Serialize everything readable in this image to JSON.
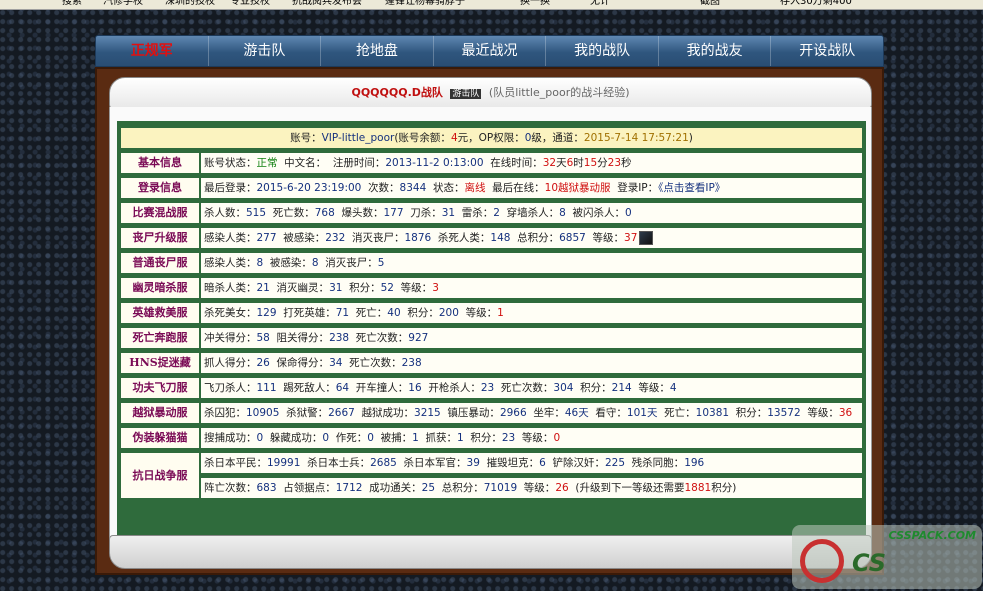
{
  "browser": {
    "items": [
      "搜索",
      "汽修学校",
      "深圳的技校",
      "专业技校",
      "抗战阅兵发布会",
      "蓬锋让杨幂骑脖子",
      "换一换",
      "无计",
      "截图",
      "存入30万剩400"
    ]
  },
  "nav": [
    "正规军",
    "游击队",
    "抢地盘",
    "最近战况",
    "我的战队",
    "我的战友",
    "开设战队"
  ],
  "header": {
    "team": "QQQQQQ.D战队",
    "badge": "游击队",
    "note": "(队员little_poor的战斗经验)"
  },
  "account": {
    "pre": "账号：",
    "id": "VIP-little_poor",
    "bal_pre": "(账号余额：",
    "bal": "4",
    "bal_unit": "元，OP权限：",
    "op": "0",
    "op_unit": "级，通道：",
    "time": "2015-7-14 17:57:21",
    "tail": ")"
  },
  "rows": [
    {
      "label": "基本信息",
      "parts": [
        [
          "k",
          "账号状态："
        ],
        [
          "g",
          "正常"
        ],
        [
          "k",
          "  中文名：  注册时间："
        ],
        [
          "n",
          "2013-11-2 0:13:00"
        ],
        [
          "k",
          "  在线时间："
        ],
        [
          "r",
          "32"
        ],
        [
          "k",
          "天"
        ],
        [
          "r",
          "6"
        ],
        [
          "k",
          "时"
        ],
        [
          "r",
          "15"
        ],
        [
          "k",
          "分"
        ],
        [
          "r",
          "23"
        ],
        [
          "k",
          "秒"
        ]
      ]
    },
    {
      "label": "登录信息",
      "parts": [
        [
          "k",
          "最后登录："
        ],
        [
          "n",
          "2015-6-20 23:19:00"
        ],
        [
          "k",
          "  次数："
        ],
        [
          "n",
          "8344"
        ],
        [
          "k",
          "  状态："
        ],
        [
          "r",
          "离线"
        ],
        [
          "k",
          "  最后在线："
        ],
        [
          "r",
          "10越狱暴动服"
        ],
        [
          "k",
          "  登录IP："
        ],
        [
          "n",
          "《点击查看IP》"
        ]
      ]
    },
    {
      "label": "比赛混战服",
      "parts": [
        [
          "k",
          "杀人数："
        ],
        [
          "n",
          "515"
        ],
        [
          "k",
          "  死亡数："
        ],
        [
          "n",
          "768"
        ],
        [
          "k",
          "  爆头数："
        ],
        [
          "n",
          "177"
        ],
        [
          "k",
          "  刀杀："
        ],
        [
          "n",
          "31"
        ],
        [
          "k",
          "  雷杀："
        ],
        [
          "n",
          "2"
        ],
        [
          "k",
          "  穿墙杀人："
        ],
        [
          "n",
          "8"
        ],
        [
          "k",
          "  被闪杀人："
        ],
        [
          "n",
          "0"
        ]
      ]
    },
    {
      "label": "丧尸升级服",
      "parts": [
        [
          "k",
          "感染人类："
        ],
        [
          "n",
          "277"
        ],
        [
          "k",
          "  被感染："
        ],
        [
          "n",
          "232"
        ],
        [
          "k",
          "  消灭丧尸："
        ],
        [
          "n",
          "1876"
        ],
        [
          "k",
          "  杀死人类："
        ],
        [
          "n",
          "148"
        ],
        [
          "k",
          "  总积分："
        ],
        [
          "n",
          "6857"
        ],
        [
          "k",
          "  等级："
        ],
        [
          "r",
          "37"
        ]
      ],
      "thumb": true
    },
    {
      "label": "普通丧尸服",
      "parts": [
        [
          "k",
          "感染人类："
        ],
        [
          "n",
          "8"
        ],
        [
          "k",
          "  被感染："
        ],
        [
          "n",
          "8"
        ],
        [
          "k",
          "  消灭丧尸："
        ],
        [
          "n",
          "5"
        ]
      ]
    },
    {
      "label": "幽灵暗杀服",
      "parts": [
        [
          "k",
          "暗杀人类："
        ],
        [
          "n",
          "21"
        ],
        [
          "k",
          "  消灭幽灵："
        ],
        [
          "n",
          "31"
        ],
        [
          "k",
          "  积分："
        ],
        [
          "n",
          "52"
        ],
        [
          "k",
          "  等级："
        ],
        [
          "r",
          "3"
        ]
      ]
    },
    {
      "label": "英雄救美服",
      "parts": [
        [
          "k",
          "杀死美女："
        ],
        [
          "n",
          "129"
        ],
        [
          "k",
          "  打死英雄："
        ],
        [
          "n",
          "71"
        ],
        [
          "k",
          "  死亡："
        ],
        [
          "n",
          "40"
        ],
        [
          "k",
          "  积分："
        ],
        [
          "n",
          "200"
        ],
        [
          "k",
          "  等级："
        ],
        [
          "r",
          "1"
        ]
      ]
    },
    {
      "label": "死亡奔跑服",
      "parts": [
        [
          "k",
          "冲关得分："
        ],
        [
          "n",
          "58"
        ],
        [
          "k",
          "  阻关得分："
        ],
        [
          "n",
          "238"
        ],
        [
          "k",
          "  死亡次数："
        ],
        [
          "n",
          "927"
        ]
      ]
    },
    {
      "label": "HNS捉迷藏",
      "parts": [
        [
          "k",
          "抓人得分："
        ],
        [
          "n",
          "26"
        ],
        [
          "k",
          "  保命得分："
        ],
        [
          "n",
          "34"
        ],
        [
          "k",
          "  死亡次数："
        ],
        [
          "n",
          "238"
        ]
      ]
    },
    {
      "label": "功夫飞刀服",
      "parts": [
        [
          "k",
          "飞刀杀人："
        ],
        [
          "n",
          "111"
        ],
        [
          "k",
          "  踢死敌人："
        ],
        [
          "n",
          "64"
        ],
        [
          "k",
          "  开车撞人："
        ],
        [
          "n",
          "16"
        ],
        [
          "k",
          "  开枪杀人："
        ],
        [
          "n",
          "23"
        ],
        [
          "k",
          "  死亡次数："
        ],
        [
          "n",
          "304"
        ],
        [
          "k",
          "  积分："
        ],
        [
          "n",
          "214"
        ],
        [
          "k",
          "  等级："
        ],
        [
          "n",
          "4"
        ]
      ]
    },
    {
      "label": "越狱暴动服",
      "parts": [
        [
          "k",
          "杀囚犯："
        ],
        [
          "n",
          "10905"
        ],
        [
          "k",
          "  杀狱警："
        ],
        [
          "n",
          "2667"
        ],
        [
          "k",
          "  越狱成功："
        ],
        [
          "n",
          "3215"
        ],
        [
          "k",
          "  镇压暴动："
        ],
        [
          "n",
          "2966"
        ],
        [
          "k",
          "  坐牢："
        ],
        [
          "n",
          "46天"
        ],
        [
          "k",
          "  看守："
        ],
        [
          "n",
          "101天"
        ],
        [
          "k",
          "  死亡："
        ],
        [
          "n",
          "10381"
        ],
        [
          "k",
          "  积分："
        ],
        [
          "n",
          "13572"
        ],
        [
          "k",
          "  等级："
        ],
        [
          "r",
          "36"
        ]
      ]
    },
    {
      "label": "伪装躲猫猫",
      "parts": [
        [
          "k",
          "搜捕成功："
        ],
        [
          "n",
          "0"
        ],
        [
          "k",
          "  躲藏成功："
        ],
        [
          "n",
          "0"
        ],
        [
          "k",
          "  作死："
        ],
        [
          "n",
          "0"
        ],
        [
          "k",
          "  被捕："
        ],
        [
          "n",
          "1"
        ],
        [
          "k",
          "  抓获："
        ],
        [
          "n",
          "1"
        ],
        [
          "k",
          "  积分："
        ],
        [
          "n",
          "23"
        ],
        [
          "k",
          "  等级："
        ],
        [
          "r",
          "0"
        ]
      ]
    },
    {
      "label": "抗日战争服",
      "parts": [
        [
          "k",
          "杀日本平民："
        ],
        [
          "n",
          "19991"
        ],
        [
          "k",
          "  杀日本士兵："
        ],
        [
          "n",
          "2685"
        ],
        [
          "k",
          "  杀日本军官："
        ],
        [
          "n",
          "39"
        ],
        [
          "k",
          "  摧毁坦克："
        ],
        [
          "n",
          "6"
        ],
        [
          "k",
          "  铲除汉奸："
        ],
        [
          "n",
          "225"
        ],
        [
          "k",
          "  残杀同胞："
        ],
        [
          "n",
          "196"
        ]
      ],
      "parts2": [
        [
          "k",
          "阵亡次数："
        ],
        [
          "n",
          "683"
        ],
        [
          "k",
          "  占领据点："
        ],
        [
          "n",
          "1712"
        ],
        [
          "k",
          "  成功通关："
        ],
        [
          "n",
          "25"
        ],
        [
          "k",
          "  总积分："
        ],
        [
          "n",
          "71019"
        ],
        [
          "k",
          "  等级："
        ],
        [
          "r",
          "26"
        ],
        [
          "k",
          "  (升级到下一等级还需要"
        ],
        [
          "r",
          "1881"
        ],
        [
          "k",
          "积分)"
        ]
      ]
    }
  ],
  "logo": {
    "url": "CSSPACK.COM",
    "mark": "CS"
  }
}
